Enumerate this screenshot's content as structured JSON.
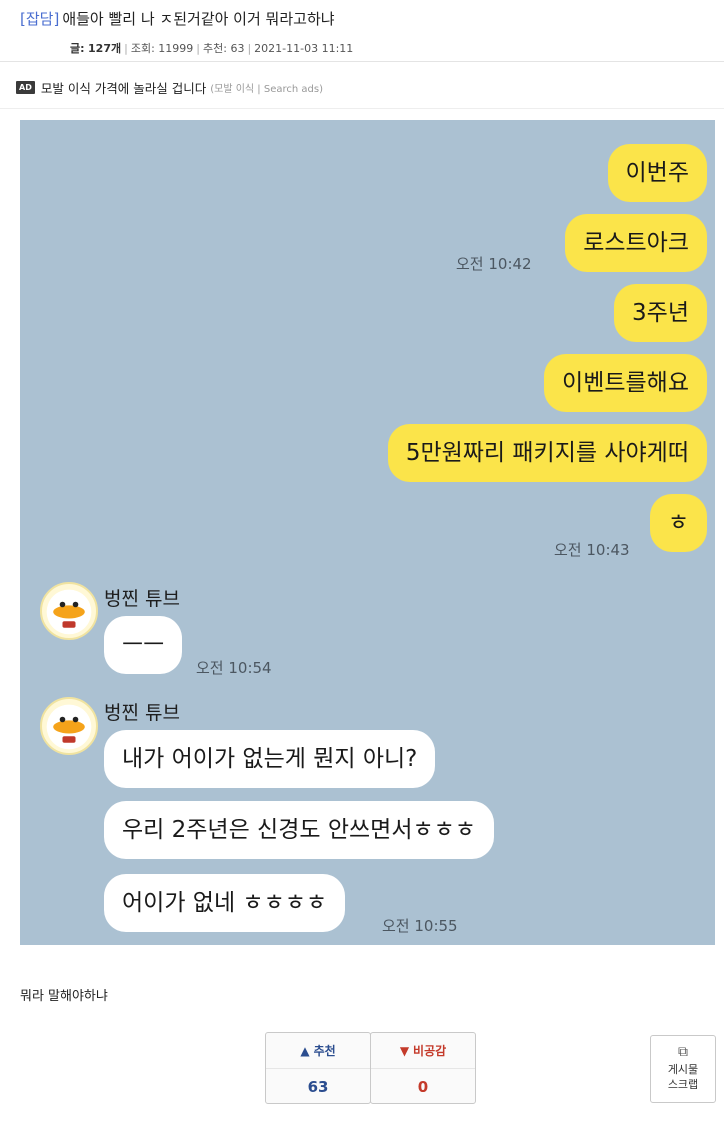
{
  "post": {
    "category": "[잡담]",
    "title": "애들아 빨리 나 ㅈ된거같아 이거 뭐라고하냐",
    "author_label": "글:",
    "comments": "127개",
    "views_label": "조회: 11999",
    "recommend_label": "추천: 63",
    "date": "2021-11-03 11:11",
    "body": "뭐라 말해야하냐"
  },
  "ad": {
    "badge": "AD",
    "text": "모발 이식 가격에 놀라실 겁니다",
    "sub": "(모발 이식 | Search ads)"
  },
  "chat": {
    "sender": "벙찐 튜브",
    "mine_messages": [
      "이번주",
      "로스트아크",
      "3주년",
      "이벤트를해요",
      "5만원짜리 패키지를 사야게떠",
      "ㅎ"
    ],
    "mine_times": [
      "오전 10:42",
      "오전 10:43"
    ],
    "theirs_group1": [
      "ㅡㅡ"
    ],
    "theirs_time1": "오전 10:54",
    "theirs_group2": [
      "내가 어이가 없는게 뭔지 아니?",
      "우리 2주년은 신경도 안쓰면서ㅎㅎㅎ",
      "어이가 없네 ㅎㅎㅎㅎ"
    ],
    "theirs_time2": "오전 10:55",
    "bg_color": "#abc1d2",
    "mine_color": "#fbe44a",
    "theirs_color": "#ffffff"
  },
  "buttons": {
    "up_label": "추천",
    "up_count": "63",
    "down_label": "비공감",
    "down_count": "0",
    "scrap_line1": "게시물",
    "scrap_line2": "스크랩"
  }
}
